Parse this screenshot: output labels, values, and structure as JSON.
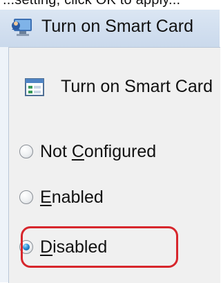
{
  "cropped_text": "...setting, click OK to apply...",
  "window": {
    "title": "Turn on Smart Card"
  },
  "policy": {
    "heading": "Turn on Smart Card"
  },
  "options": [
    {
      "label_prefix": "Not ",
      "mnemonic": "C",
      "label_suffix": "onfigured",
      "checked": false
    },
    {
      "label_prefix": "",
      "mnemonic": "E",
      "label_suffix": "nabled",
      "checked": false
    },
    {
      "label_prefix": "",
      "mnemonic": "D",
      "label_suffix": "isabled",
      "checked": true
    }
  ],
  "colors": {
    "highlight": "#d7262c",
    "radio_dot": "#2c8fd6"
  }
}
